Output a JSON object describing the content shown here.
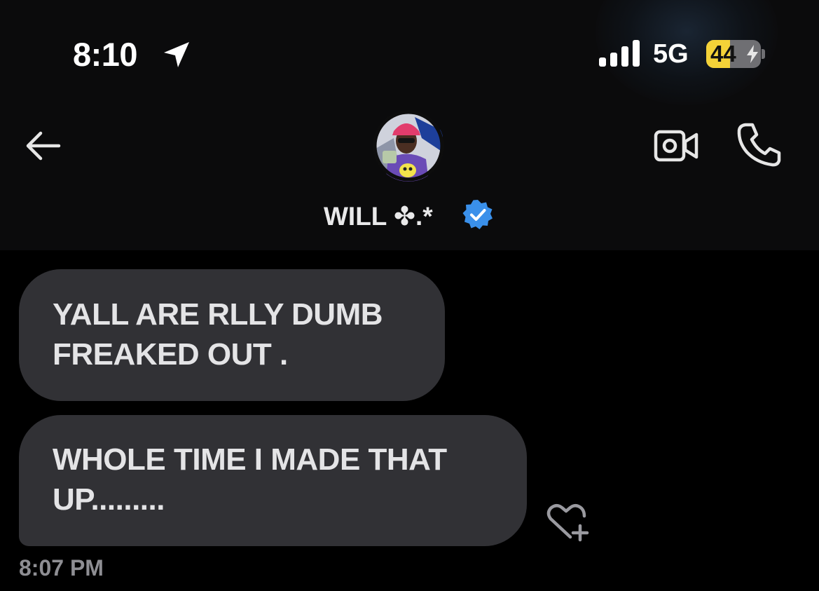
{
  "status_bar": {
    "time": "8:10",
    "network": "5G",
    "battery_percent": "44",
    "battery_level": 0.44,
    "icons": [
      "location-arrow-icon",
      "cellular-signal-icon",
      "charging-bolt-icon"
    ]
  },
  "header": {
    "contact_name": "WILL ✤.*",
    "verified": true,
    "icons": [
      "back-arrow-icon",
      "video-camera-icon",
      "phone-icon",
      "verified-badge-icon"
    ]
  },
  "messages": [
    {
      "text": "YALL ARE RLLY DUMB FREAKED OUT ."
    },
    {
      "text": "WHOLE TIME I MADE THAT UP........."
    }
  ],
  "reaction": {
    "icon": "heart-plus-icon"
  },
  "timestamp": "8:07 PM",
  "colors": {
    "background": "#000000",
    "header_background": "#0b0b0c",
    "bubble": "#313135",
    "bubble_text": "#e4e4e6",
    "timestamp_text": "#8e8e93",
    "verified_blue": "#3a90ea",
    "battery_yellow": "#f4d238"
  }
}
